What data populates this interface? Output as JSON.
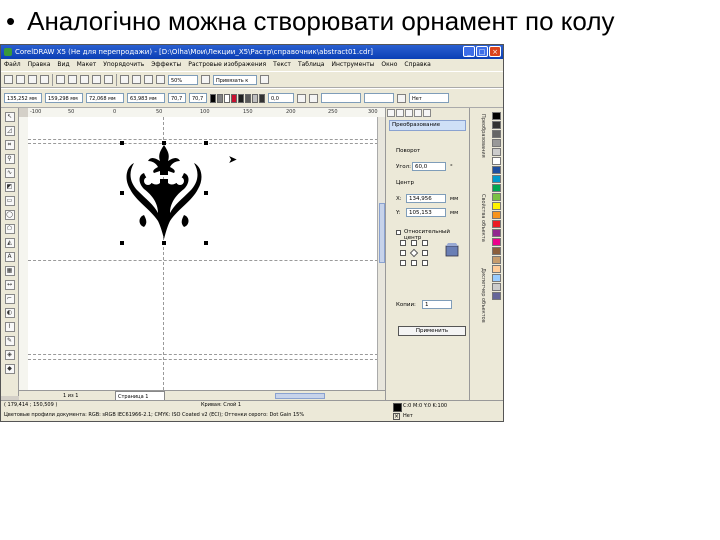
{
  "slide": {
    "bullet": "•",
    "title": "Аналогічно можна створювати орнамент по колу"
  },
  "window": {
    "title": "CorelDRAW X5 (Не для перепродажи) - [D:\\Olha\\Мои\\Лекции_X5\\Растр\\справочник\\abstract01.cdr]",
    "controls": {
      "minimize": "_",
      "maximize": "□",
      "close": "×"
    }
  },
  "menu": [
    "Файл",
    "Правка",
    "Вид",
    "Макет",
    "Упорядочить",
    "Эффекты",
    "Растровые изображения",
    "Текст",
    "Таблица",
    "Инструменты",
    "Окно",
    "Справка"
  ],
  "toolbar": {
    "zoom": "50%",
    "snap_label": "Привязать к",
    "x_value": "135,252 мм",
    "y_value": "159,298 мм",
    "width_value": "72,068 мм",
    "height_value": "63,983 мм",
    "scale_x": "70,7",
    "scale_y": "70,7",
    "rotation": "0,0",
    "font_size": "Нет"
  },
  "colors": {
    "toolbar_swatches": [
      "#000000",
      "#7f7f7f",
      "#ffffff",
      "#c8102e",
      "#1f1f1f",
      "#5a5a5a",
      "#bfbfbf",
      "#333333"
    ],
    "palette": [
      "#000000",
      "#333333",
      "#666666",
      "#999999",
      "#cccccc",
      "#ffffff",
      "#1e4fa0",
      "#0099cc",
      "#00a651",
      "#7ac143",
      "#fff200",
      "#f7941d",
      "#ed1c24",
      "#92278f",
      "#ec008c",
      "#8b5e3c",
      "#c69c6d",
      "#ffcc99",
      "#99ccff",
      "#cccccc",
      "#666699"
    ]
  },
  "ruler": {
    "ticks": [
      "-100",
      "50",
      "0",
      "50",
      "100",
      "150",
      "200",
      "250",
      "300"
    ]
  },
  "docker": {
    "title": "Преобразование",
    "rotate_label": "Поворот",
    "angle_label": "Угол:",
    "angle_value": "60,0",
    "angle_unit": "°",
    "center_label": "Центр",
    "center_x_label": "X:",
    "center_x_value": "134,956",
    "center_y_label": "Y:",
    "center_y_value": "105,153",
    "unit": "мм",
    "relative_center": "Относительный центр",
    "copies_label": "Копии:",
    "copies_value": "1",
    "apply_label": "Применить"
  },
  "side_tabs": [
    "Преобразования",
    "Свойства объекта",
    "Диспетчер объектов"
  ],
  "pagebar": {
    "counter": "1 из 1",
    "page_tab": "Страница 1"
  },
  "status": {
    "coords": "( 179,414 ; 150,509 )",
    "selection": "Кривая: Слой 1",
    "profile": "Цветовые профили документа: RGB: sRGB IEC61966-2.1; CMYK: ISO Coated v2 (ECI); Оттенки серого: Dot Gain 15%",
    "fill": "C:0 M:0 Y:0 K:100",
    "outline": "Нет"
  }
}
